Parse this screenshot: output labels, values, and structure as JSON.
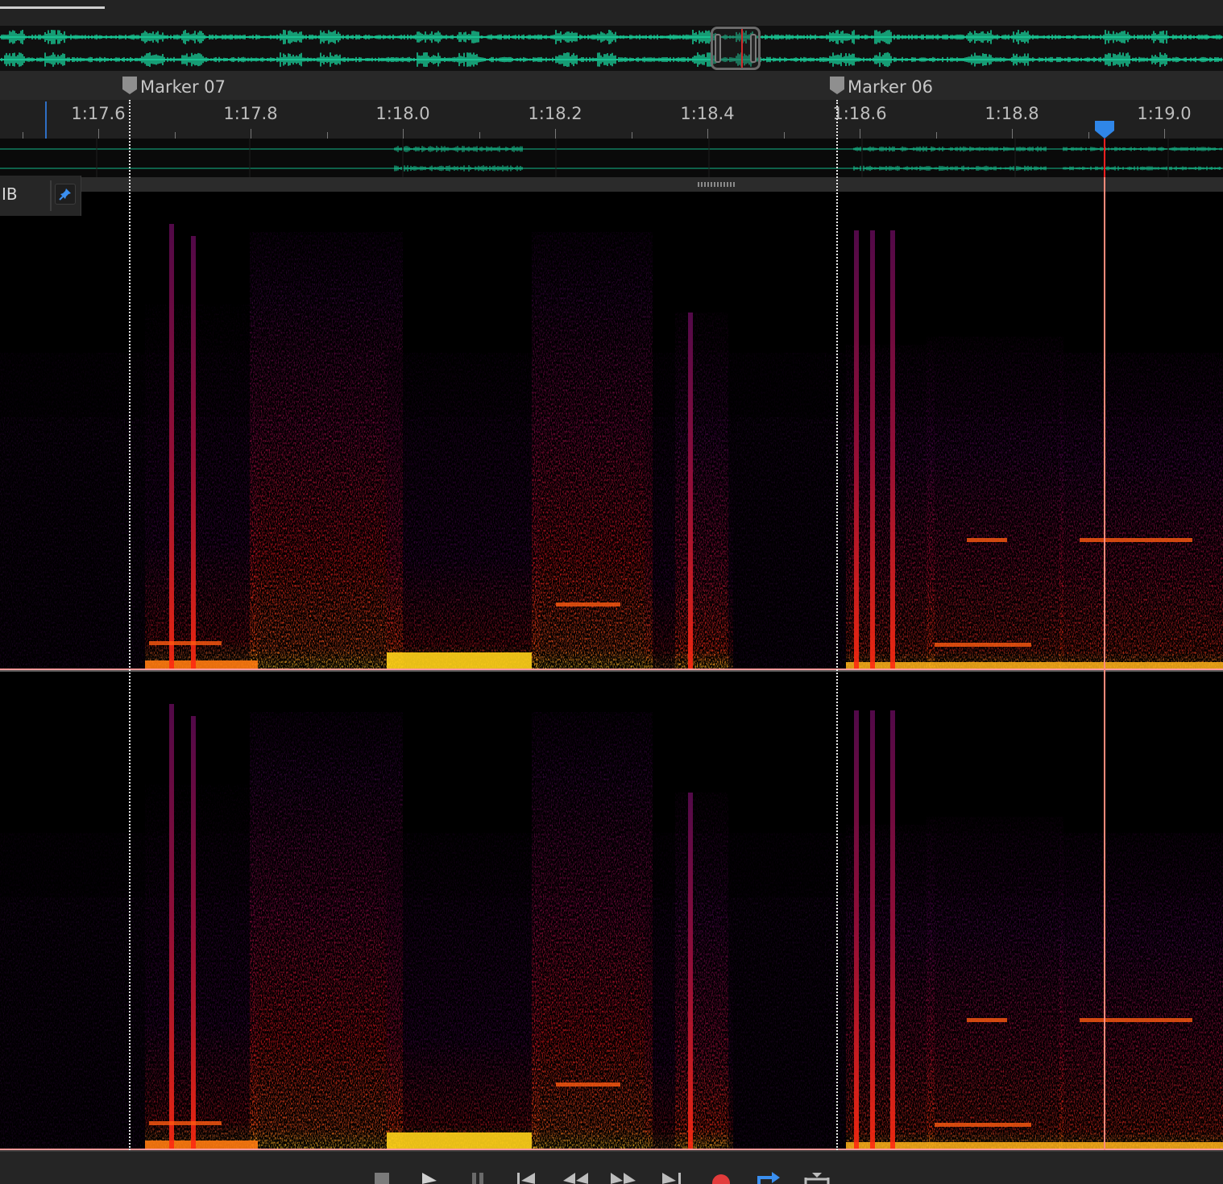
{
  "app": {
    "panel": "waveform-spectral-editor"
  },
  "markers": [
    {
      "label": "Marker 07"
    },
    {
      "label": "Marker 06"
    }
  ],
  "timeline": {
    "tick_labels": [
      "1:17.6",
      "1:17.8",
      "1:18.0",
      "1:18.2",
      "1:18.4",
      "1:18.6",
      "1:18.8",
      "1:19.0"
    ]
  },
  "hud": {
    "unit_fragment": "IB",
    "pin_icon": "pin-icon"
  },
  "colors": {
    "waveform": "#19d8a0",
    "playhead": "#ff8a7a",
    "cti": "#2f86e8",
    "record": "#e23b3b",
    "spectral_hot": "#ffd21a",
    "spectral_mid": "#ff2a10",
    "spectral_low": "#4a0a4a"
  },
  "transport": {
    "buttons": [
      "stop-icon",
      "play-icon",
      "pause-icon",
      "go-to-start-icon",
      "rewind-icon",
      "fast-forward-icon",
      "go-to-end-icon",
      "record-icon",
      "loop-icon",
      "skip-selection-icon"
    ]
  }
}
